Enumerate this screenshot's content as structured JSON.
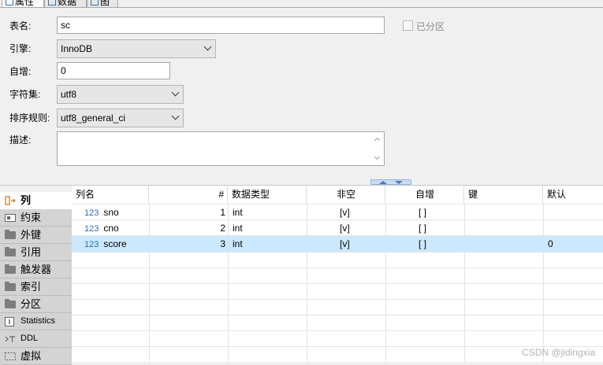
{
  "tabs": [
    {
      "label": "属性"
    },
    {
      "label": "数据"
    },
    {
      "label": "图"
    }
  ],
  "form": {
    "table_name_label": "表名:",
    "table_name_value": "sc",
    "partitioned_label": "已分区",
    "engine_label": "引擎:",
    "engine_value": "InnoDB",
    "auto_increment_label": "自增:",
    "auto_increment_value": "0",
    "charset_label": "字符集:",
    "charset_value": "utf8",
    "collation_label": "排序规则:",
    "collation_value": "utf8_general_ci",
    "description_label": "描述:",
    "description_value": ""
  },
  "side_menu": [
    {
      "label": "列",
      "icon": "columns-icon"
    },
    {
      "label": "约束",
      "icon": "constraint-icon"
    },
    {
      "label": "外键",
      "icon": "folder-icon"
    },
    {
      "label": "引用",
      "icon": "folder-icon"
    },
    {
      "label": "触发器",
      "icon": "folder-icon"
    },
    {
      "label": "索引",
      "icon": "folder-icon"
    },
    {
      "label": "分区",
      "icon": "folder-icon"
    },
    {
      "label": "Statistics",
      "icon": "statistics-icon"
    },
    {
      "label": "DDL",
      "icon": "ddl-icon"
    },
    {
      "label": "虚拟",
      "icon": "virtual-icon"
    }
  ],
  "grid": {
    "headers": [
      "列名",
      "#",
      "数据类型",
      "非空",
      "自增",
      "键",
      "默认"
    ],
    "type_icon": "123",
    "rows": [
      {
        "name": "sno",
        "num": "1",
        "type": "int",
        "not_null": "[v]",
        "auto_inc": "[ ]",
        "key": "",
        "default": ""
      },
      {
        "name": "cno",
        "num": "2",
        "type": "int",
        "not_null": "[v]",
        "auto_inc": "[ ]",
        "key": "",
        "default": ""
      },
      {
        "name": "score",
        "num": "3",
        "type": "int",
        "not_null": "[v]",
        "auto_inc": "[ ]",
        "key": "",
        "default": "0"
      }
    ],
    "selected_row": 2
  },
  "watermark": "CSDN @jidingxia",
  "colors": {
    "selection": "#cce8ff",
    "panel": "#f0f0f0",
    "icon_blue": "#2b6cb5"
  }
}
